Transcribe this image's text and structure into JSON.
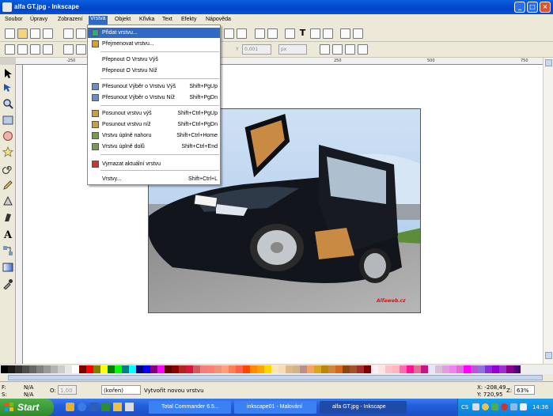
{
  "window": {
    "title": "alfa GT.jpg - Inkscape",
    "min": "_",
    "max": "□",
    "close": "×"
  },
  "menubar": [
    "Soubor",
    "Úpravy",
    "Zobrazení",
    "Vrstva",
    "Objekt",
    "Křivka",
    "Text",
    "Efekty",
    "Nápověda"
  ],
  "active_menu": "Vrstva",
  "toolbar2": {
    "y_label": "Y",
    "y_value": "0,001",
    "unit": "px"
  },
  "ruler_h": [
    "-250",
    "0",
    "250",
    "500",
    "750"
  ],
  "layer_menu": [
    {
      "label": "Přidat vrstvu...",
      "shortcut": "",
      "icon": "add-layer-icon"
    },
    {
      "label": "Přejmenovat vrstvu...",
      "shortcut": "",
      "icon": "rename-layer-icon"
    },
    {
      "label": "Přepnout O Vrstvu Výš",
      "shortcut": "",
      "icon": ""
    },
    {
      "label": "Přepnout O Vrstvu Níž",
      "shortcut": "",
      "icon": ""
    },
    {
      "label": "Přesunout Výběr o Vrstvu Výš",
      "shortcut": "Shift+PgUp",
      "icon": "move-selection-up-icon"
    },
    {
      "label": "Přesunout Výběr o Vrstvu Níž",
      "shortcut": "Shift+PgDn",
      "icon": "move-selection-down-icon"
    },
    {
      "label": "Posunout vrstvu výš",
      "shortcut": "Shift+Ctrl+PgUp",
      "icon": "raise-layer-icon"
    },
    {
      "label": "Posunout vrstvu níž",
      "shortcut": "Shift+Ctrl+PgDn",
      "icon": "lower-layer-icon"
    },
    {
      "label": "Vrstvu úplně nahoru",
      "shortcut": "Shift+Ctrl+Home",
      "icon": "layer-top-icon"
    },
    {
      "label": "Vrstvu úplně dolů",
      "shortcut": "Shift+Ctrl+End",
      "icon": "layer-bottom-icon"
    },
    {
      "label": "Vymazat aktuální vrstvu",
      "shortcut": "",
      "icon": "delete-layer-icon"
    },
    {
      "label": "Vrstvy...",
      "shortcut": "Shift+Ctrl+L",
      "icon": ""
    }
  ],
  "photo": {
    "watermark": "Alfaweb.cz"
  },
  "status": {
    "fill_label": "F:",
    "fill_value": "N/A",
    "stroke_label": "S:",
    "stroke_value": "N/A",
    "opacity_label": "O:",
    "opacity_value": "1,00",
    "layer": "(kořen)",
    "message": "Vytvořit novou vrstvu",
    "x_coord": "X: -208,49",
    "y_coord": "Y: 720,95",
    "zoom_label": "Z:",
    "zoom": "63%"
  },
  "taskbar": {
    "start": "Start",
    "tasks": [
      "Total Commander 6.5...",
      "inkscape01 - Malování",
      "alfa GT.jpg - Inkscape"
    ],
    "active_task": 2,
    "tray_lang": "CS",
    "clock": "14:36"
  },
  "palette": [
    "#000000",
    "#1a1a1a",
    "#333333",
    "#4d4d4d",
    "#666666",
    "#808080",
    "#999999",
    "#b3b3b3",
    "#cccccc",
    "#e6e6e6",
    "#ffffff",
    "#800000",
    "#ff0000",
    "#808000",
    "#ffff00",
    "#008000",
    "#00ff00",
    "#008080",
    "#00ffff",
    "#000080",
    "#0000ff",
    "#800080",
    "#ff00ff",
    "#5c0000",
    "#8b0000",
    "#b22222",
    "#dc143c",
    "#cd5c5c",
    "#f08080",
    "#fa8072",
    "#e9967a",
    "#ffa07a",
    "#ff7f50",
    "#ff6347",
    "#ff4500",
    "#ff8c00",
    "#ffa500",
    "#ffd700",
    "#ffe4b5",
    "#f5deb3",
    "#deb887",
    "#d2b48c",
    "#bc8f8f",
    "#f4a460",
    "#daa520",
    "#b8860b",
    "#cd853f",
    "#d2691e",
    "#8b4513",
    "#a0522d",
    "#a52a2a",
    "#800000",
    "#fff0f5",
    "#ffe4e1",
    "#ffc0cb",
    "#ffb6c1",
    "#ff69b4",
    "#ff1493",
    "#db7093",
    "#c71585",
    "#e6e6fa",
    "#d8bfd8",
    "#dda0dd",
    "#ee82ee",
    "#da70d6",
    "#ff00ff",
    "#ba55d3",
    "#9370db",
    "#8a2be2",
    "#9400d3",
    "#9932cc",
    "#8b008b",
    "#4b0082"
  ]
}
